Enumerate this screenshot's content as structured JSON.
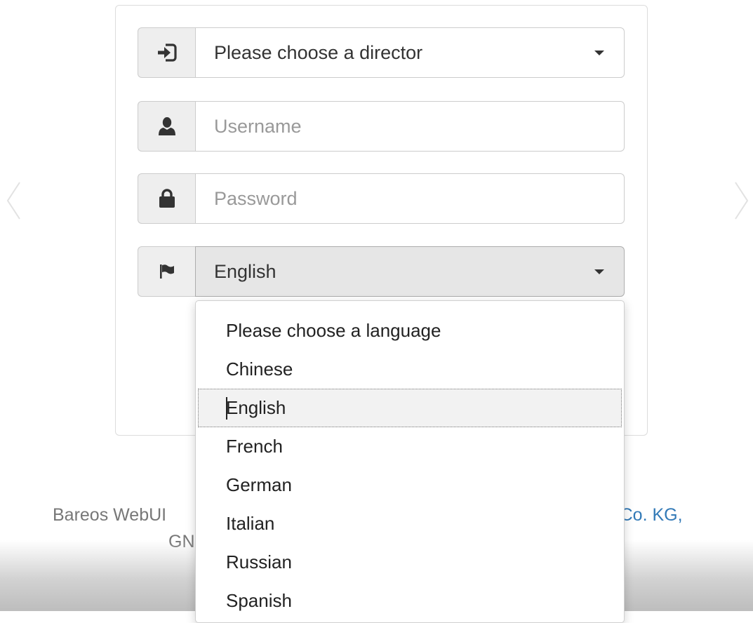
{
  "login": {
    "director": {
      "value": "Please choose a director",
      "icon": "sign-in-icon"
    },
    "username": {
      "placeholder": "Username",
      "icon": "user-icon"
    },
    "password": {
      "placeholder": "Password",
      "icon": "lock-icon"
    },
    "language": {
      "value": "English",
      "icon": "flag-icon"
    }
  },
  "language_dropdown": {
    "options": [
      "Please choose a language",
      "Chinese",
      "English",
      "French",
      "German",
      "Italian",
      "Russian",
      "Spanish"
    ],
    "selected": "English"
  },
  "footer": {
    "line1_left": "Bareos WebUI",
    "line1_right": "& Co. KG,",
    "line2": "GN"
  },
  "colors": {
    "link": "#337ab7",
    "addon_bg": "#eeeeee",
    "border": "#cccccc"
  }
}
